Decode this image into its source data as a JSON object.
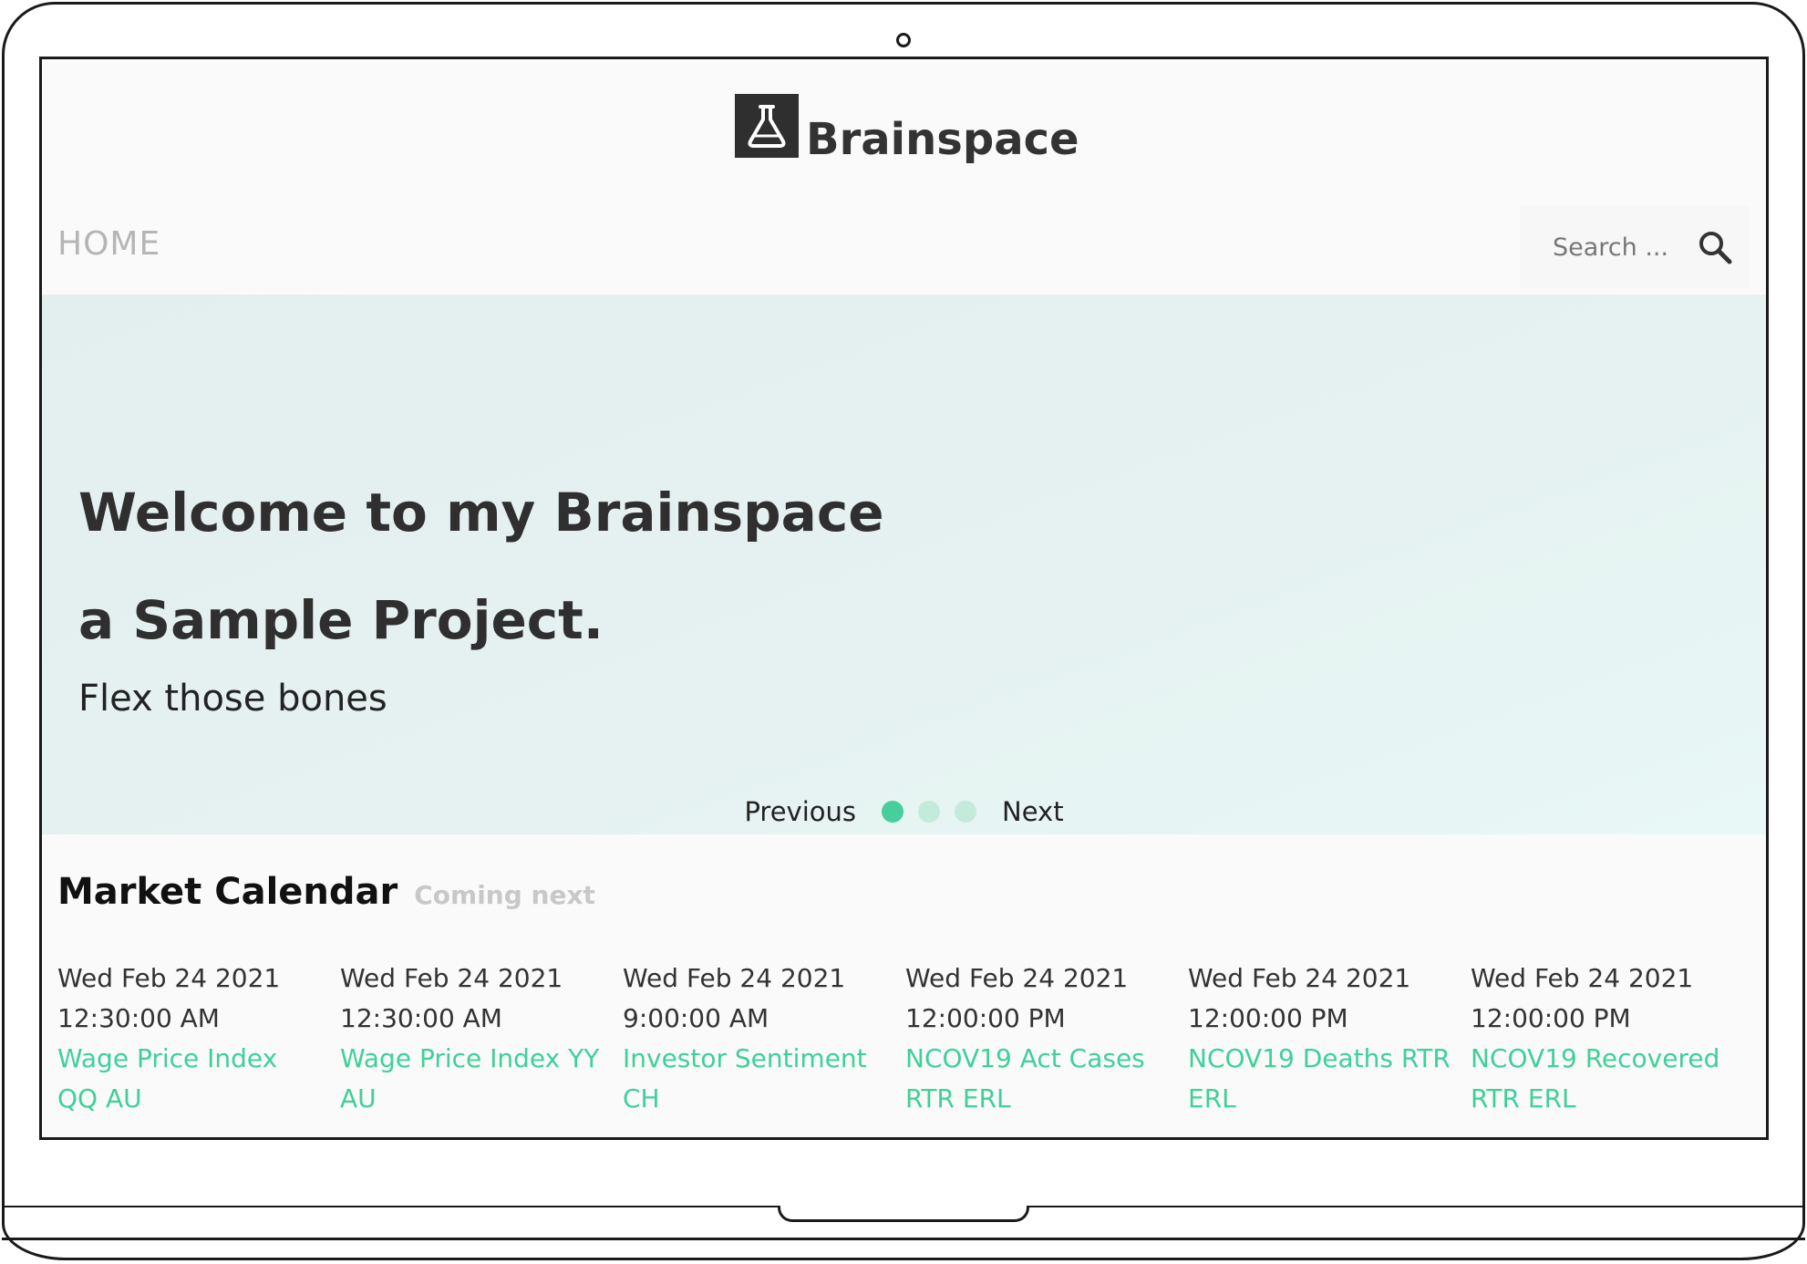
{
  "brand": {
    "name": "Brainspace"
  },
  "nav": {
    "home_label": "HOME"
  },
  "search": {
    "placeholder": "Search ..."
  },
  "hero": {
    "title_line1": "Welcome to my Brainspace",
    "title_line2": "a Sample Project.",
    "subtitle": "Flex those bones",
    "previous_label": "Previous",
    "next_label": "Next",
    "slides_total": 3,
    "active_slide": 1
  },
  "calendar": {
    "title": "Market Calendar",
    "subtitle": "Coming next",
    "events": [
      {
        "date": "Wed Feb 24 2021",
        "time": "12:30:00 AM",
        "name": "Wage Price Index QQ AU"
      },
      {
        "date": "Wed Feb 24 2021",
        "time": "12:30:00 AM",
        "name": "Wage Price Index YY AU"
      },
      {
        "date": "Wed Feb 24 2021",
        "time": "9:00:00 AM",
        "name": "Investor Sentiment CH"
      },
      {
        "date": "Wed Feb 24 2021",
        "time": "12:00:00 PM",
        "name": "NCOV19 Act Cases RTR ERL"
      },
      {
        "date": "Wed Feb 24 2021",
        "time": "12:00:00 PM",
        "name": "NCOV19 Deaths RTR ERL"
      },
      {
        "date": "Wed Feb 24 2021",
        "time": "12:00:00 PM",
        "name": "NCOV19 Recovered RTR ERL"
      }
    ]
  },
  "icons": {
    "logo": "flask-icon",
    "search": "search-icon"
  },
  "colors": {
    "accent": "#3fd09a",
    "dot_active": "#46cf9c",
    "dot_inactive": "#c4eadc",
    "hero_bg": "#e4f1f0",
    "logo_bg": "#2f2f2f",
    "text_dark": "#2f2f2f",
    "nav_muted": "#b5b5b5"
  }
}
